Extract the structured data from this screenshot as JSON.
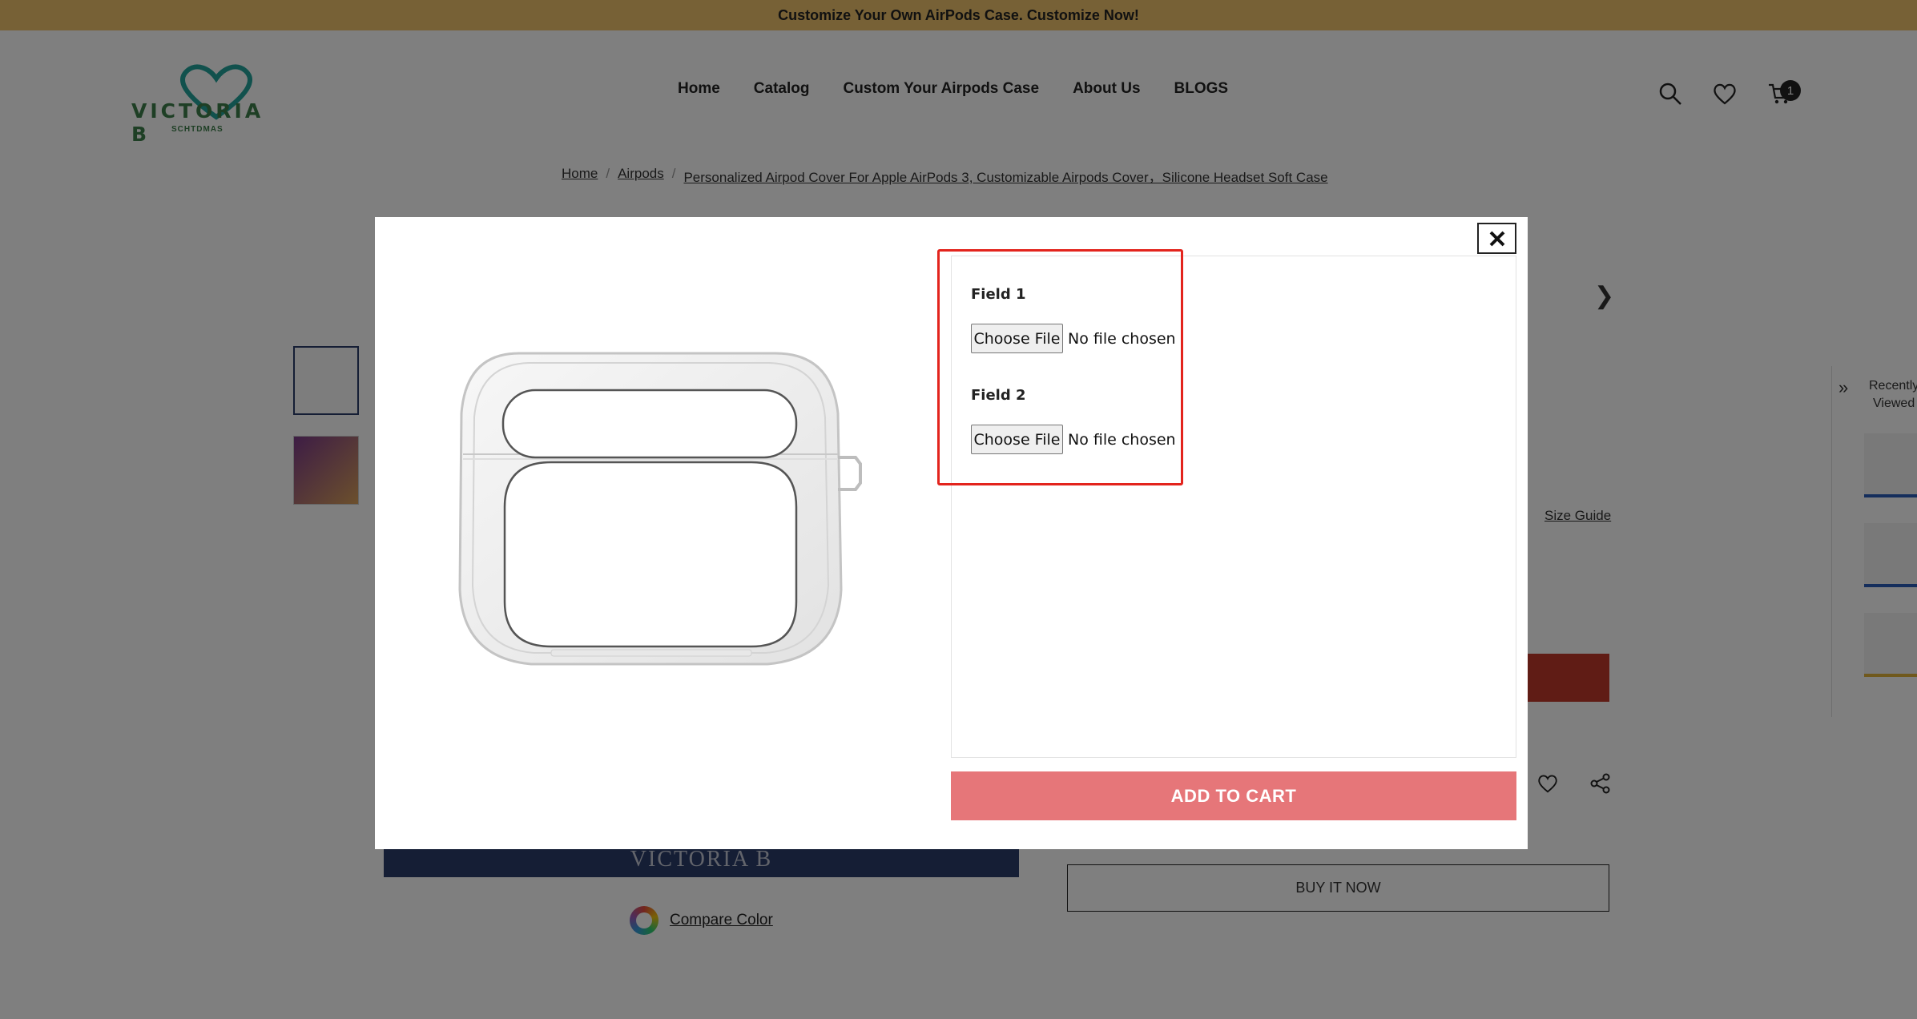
{
  "announcement": "Customize Your Own AirPods Case. Customize Now!",
  "logo": {
    "text": "VICTORIA B",
    "subtext": "SCHTDMAS"
  },
  "nav": [
    "Home",
    "Catalog",
    "Custom Your Airpods Case",
    "About Us",
    "BLOGS"
  ],
  "header_icons": [
    "search-icon",
    "heart-icon",
    "cart-icon"
  ],
  "cart_count": "1",
  "breadcrumb": {
    "items": [
      "Home",
      "Airpods",
      "Personalized Airpod Cover For Apple AirPods 3, Customizable Airpods Cover，Silicone Headset Soft Case"
    ],
    "separator": "/"
  },
  "product_page": {
    "banner_text": "VICTORIA B",
    "compare_color": "Compare Color",
    "size_guide": "Size Guide",
    "buy_it_now": "BUY IT NOW",
    "recently_viewed": "Recently Viewed"
  },
  "modal": {
    "fields": [
      {
        "label": "Field 1",
        "button": "Choose File",
        "status": "No file chosen"
      },
      {
        "label": "Field 2",
        "button": "Choose File",
        "status": "No file chosen"
      }
    ],
    "add_to_cart": "ADD TO CART"
  },
  "colors": {
    "announcement_bg": "#efc36c",
    "add_to_cart_bg": "#e67679",
    "highlight_border": "#e3241d",
    "navy": "#2b3d6b"
  }
}
